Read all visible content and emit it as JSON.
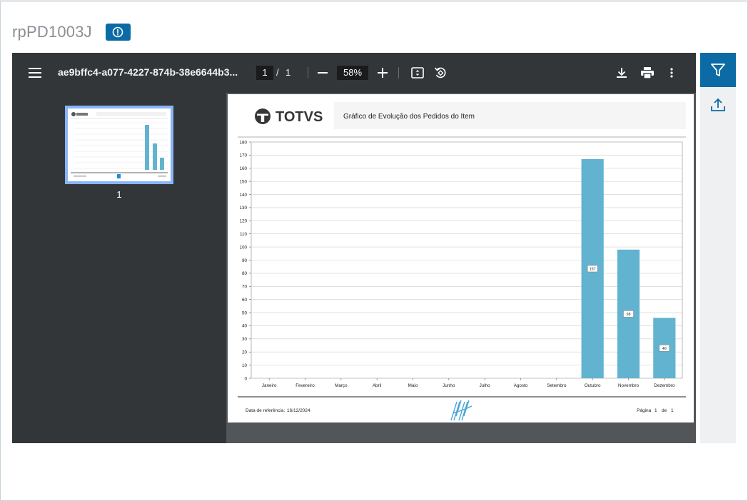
{
  "window": {
    "title": "rpPD1003J"
  },
  "icons": {
    "info": "info-circle-icon",
    "menu": "hamburger-menu-icon",
    "zoom_out": "minus-icon",
    "zoom_in": "plus-icon",
    "fit": "fit-page-icon",
    "rotate": "rotate-icon",
    "download": "download-icon",
    "print": "print-icon",
    "more": "more-vertical-icon",
    "filter": "filter-icon",
    "upload": "upload-icon"
  },
  "pdf_toolbar": {
    "doc_name": "ae9bffc4-a077-4227-874b-38e6644b3...",
    "current_page": "1",
    "page_separator": "/",
    "total_pages": "1",
    "zoom": "58%"
  },
  "sidebar": {
    "thumbnails": [
      {
        "page_label": "1"
      }
    ]
  },
  "report": {
    "logo_text": "TOTVS",
    "title": "Gráfico de Evolução dos Pedidos do Item",
    "footer_ref_label": "Data de referência:",
    "footer_ref_date": "16/12/2024",
    "footer_page_label": "Página",
    "footer_page_num": "1",
    "footer_page_of": "de",
    "footer_page_total": "1"
  },
  "colors": {
    "accent": "#0c6ba5",
    "bar": "#62b3cf",
    "toolbar_bg": "#323639",
    "viewer_bg": "#525659",
    "thumb_border": "#8ab4f8"
  },
  "chart_data": {
    "type": "bar",
    "categories": [
      "Janeiro",
      "Fevereiro",
      "Março",
      "Abril",
      "Maio",
      "Junho",
      "Julho",
      "Agosto",
      "Setembro",
      "Outubro",
      "Novembro",
      "Dezembro"
    ],
    "values": [
      0,
      0,
      0,
      0,
      0,
      0,
      0,
      0,
      0,
      167,
      98,
      46
    ],
    "data_labels": [
      "",
      "",
      "",
      "",
      "",
      "",
      "",
      "",
      "",
      "167",
      "98",
      "46"
    ],
    "yticks": [
      "0",
      "10",
      "20",
      "30",
      "40",
      "50",
      "60",
      "70",
      "80",
      "90",
      "100",
      "110",
      "120",
      "130",
      "140",
      "150",
      "160",
      "170",
      "180"
    ],
    "ylim": [
      0,
      180
    ],
    "grid": true,
    "title": "",
    "xlabel": "",
    "ylabel": ""
  }
}
